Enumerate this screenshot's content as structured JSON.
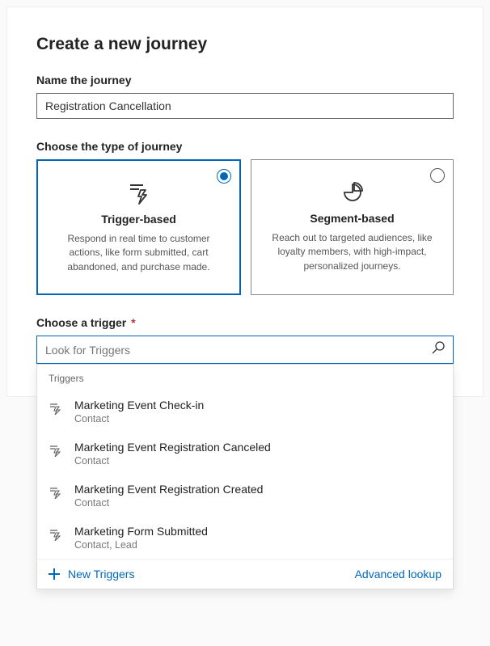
{
  "header": {
    "title": "Create a new journey"
  },
  "name_field": {
    "label": "Name the journey",
    "value": "Registration Cancellation"
  },
  "type_section": {
    "label": "Choose the type of journey",
    "options": [
      {
        "title": "Trigger-based",
        "desc": "Respond in real time to customer actions, like form submitted, cart abandoned, and purchase made.",
        "selected": true
      },
      {
        "title": "Segment-based",
        "desc": "Reach out to targeted audiences, like loyalty members, with high-impact, personalized journeys.",
        "selected": false
      }
    ]
  },
  "trigger_field": {
    "label": "Choose a trigger",
    "required_mark": "*",
    "placeholder": "Look for Triggers"
  },
  "dropdown": {
    "group_label": "Triggers",
    "items": [
      {
        "title": "Marketing Event Check-in",
        "sub": "Contact"
      },
      {
        "title": "Marketing Event Registration Canceled",
        "sub": "Contact"
      },
      {
        "title": "Marketing Event Registration Created",
        "sub": "Contact"
      },
      {
        "title": "Marketing Form Submitted",
        "sub": "Contact, Lead"
      }
    ],
    "new_label": "New Triggers",
    "advanced_label": "Advanced lookup"
  }
}
